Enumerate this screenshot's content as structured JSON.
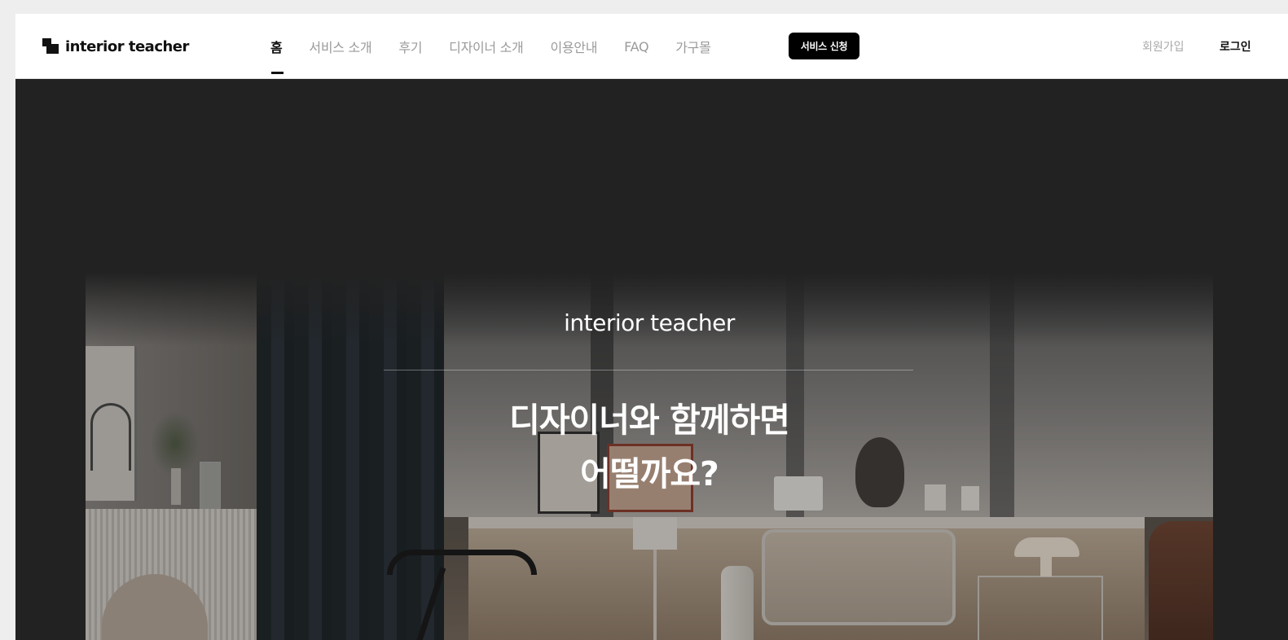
{
  "nav": {
    "logo_text": "interior teacher",
    "items": [
      {
        "label": "홈",
        "active": true
      },
      {
        "label": "서비스 소개",
        "active": false
      },
      {
        "label": "후기",
        "active": false
      },
      {
        "label": "디자이너 소개",
        "active": false
      },
      {
        "label": "이용안내",
        "active": false
      },
      {
        "label": "FAQ",
        "active": false
      },
      {
        "label": "가구몰",
        "active": false
      }
    ],
    "cta_label": "서비스 신청",
    "signup_label": "회원가입",
    "login_label": "로그인"
  },
  "hero": {
    "brand": "interior teacher",
    "headline_line1": "디자이너와 함께하면",
    "headline_line2": "어떨까요?"
  },
  "colors": {
    "nav_bg": "#ffffff",
    "page_bg": "#222222",
    "cta_bg": "#000000",
    "active_text": "#111111",
    "inactive_text": "#9a9a9a"
  },
  "icons": {
    "logo": "interior-teacher-logo-icon"
  }
}
